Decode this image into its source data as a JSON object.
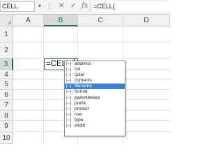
{
  "formula_bar": {
    "name_box": "CELL",
    "dots": "⋮",
    "cancel": "✕",
    "enter": "✓",
    "fx": "fx",
    "formula": "=CELL("
  },
  "grid": {
    "columns": [
      "A",
      "B",
      "C",
      "D"
    ],
    "rows": [
      "1",
      "2",
      "3",
      "4",
      "5",
      "6",
      "7",
      "8",
      "9",
      "10"
    ],
    "active_column": "B",
    "active_row": "3"
  },
  "active_cell": {
    "value": "=CELL("
  },
  "autocomplete": {
    "icon": "[--]",
    "selected": "filename",
    "items": [
      "address",
      "col",
      "color",
      "contents",
      "filename",
      "format",
      "parentheses",
      "prefix",
      "protect",
      "row",
      "type",
      "width"
    ]
  }
}
